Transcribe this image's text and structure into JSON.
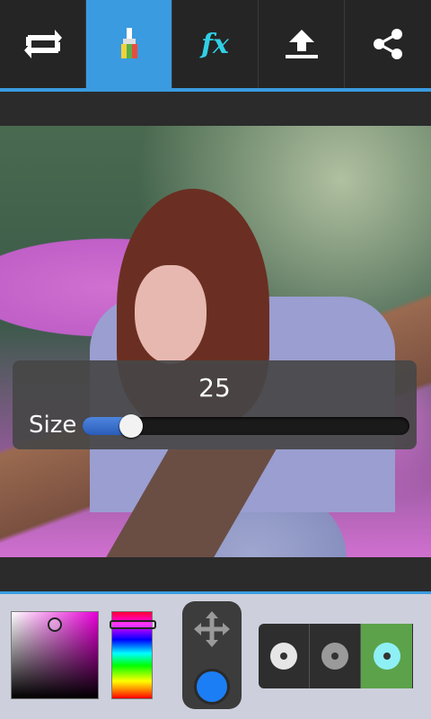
{
  "toolbar": {
    "tools": [
      {
        "icon": "swap-icon",
        "label": ""
      },
      {
        "icon": "brush-icon",
        "label": "",
        "active": true
      },
      {
        "icon": "fx-icon",
        "label": "fx"
      },
      {
        "icon": "upload-icon",
        "label": ""
      },
      {
        "icon": "share-icon",
        "label": ""
      }
    ]
  },
  "size_panel": {
    "value": "25",
    "label": "Size",
    "slider_level": 0.12
  },
  "color_picker": {
    "selected_hue": "#e800d8",
    "saturation": 0.5,
    "brightness": 0.85,
    "hue_position": 0.14
  },
  "mover": {
    "icon": "move-arrows-icon",
    "brush_color": "#1c7ef5"
  },
  "brush_options": [
    {
      "icon": "soft-brush-icon",
      "color": "#e6e6e6",
      "selected": false
    },
    {
      "icon": "medium-brush-icon",
      "color": "#9a9a9a",
      "selected": false
    },
    {
      "icon": "hard-brush-icon",
      "color": "#8ef0f5",
      "selected": true
    }
  ],
  "colors": {
    "accent": "#3a9be0",
    "toolbar_bg": "#252525",
    "selected_brush_bg": "#5ca24a"
  }
}
